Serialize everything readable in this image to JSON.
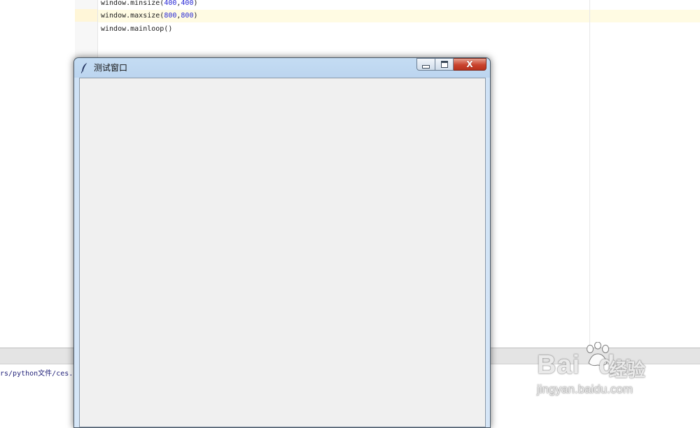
{
  "editor": {
    "lines": [
      {
        "prefix": "window.minsize(",
        "a": "400",
        "sep": ",",
        "b": "400",
        "suffix": ")"
      },
      {
        "prefix": "window.maxsize(",
        "a": "800",
        "sep": ",",
        "b": "800",
        "suffix": ")"
      },
      {
        "prefix": "window.mainloop()",
        "a": "",
        "sep": "",
        "b": "",
        "suffix": ""
      }
    ]
  },
  "console": {
    "path_text": "rs/python文件/ces.p"
  },
  "tk_window": {
    "title": "测试窗口",
    "minimize_glyph": "minimize-icon",
    "maximize_glyph": "maximize-icon",
    "close_label": "X"
  },
  "watermark": {
    "brand": "Bai",
    "brand2": "du",
    "cn": "经验",
    "url": "jingyan.baidu.com"
  },
  "colors": {
    "number": "#2a2ad6",
    "current_line": "#fffbe3",
    "client_bg": "#f0f0f0",
    "close_button": "#c9432d"
  }
}
